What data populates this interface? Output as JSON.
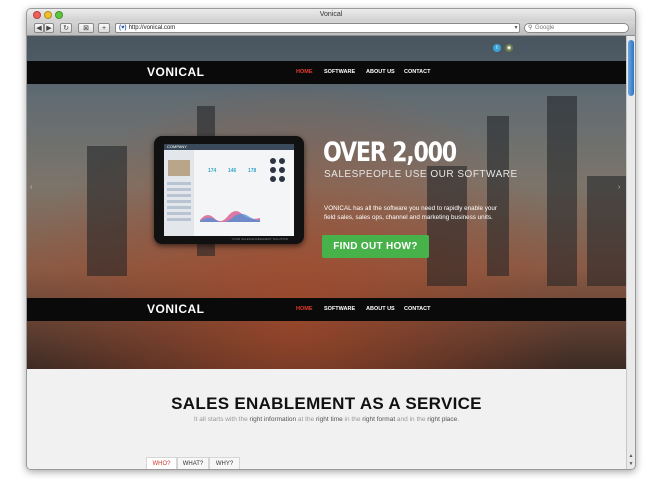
{
  "window": {
    "title": "Vonical"
  },
  "toolbar": {
    "back_icon": "back-arrow-icon",
    "forward_icon": "forward-arrow-icon",
    "reload_icon": "reload-icon",
    "url_prefix": "(♥)",
    "url": "http://vonical.com",
    "search_placeholder": "Google"
  },
  "site": {
    "logo": "VONICAL",
    "nav": [
      {
        "label": "HOME",
        "active": true
      },
      {
        "label": "SOFTWARE",
        "active": false
      },
      {
        "label": "ABOUT US",
        "active": false
      },
      {
        "label": "CONTACT",
        "active": false
      }
    ],
    "social": {
      "twitter_icon": "twitter-icon",
      "rss_icon": "rss-icon"
    }
  },
  "hero": {
    "headline": "OVER 2,000",
    "subheadline": "SALESPEOPLE USE OUR SOFTWARE",
    "body": "VONICAL has all the software you need to rapidly enable your field sales, sales ops, channel and marketing business units.",
    "cta": "FIND OUT HOW?",
    "tablet": {
      "brand": "COMPANY",
      "stats": [
        "174",
        "146",
        "178"
      ],
      "caption": "YOUR SALES ENABLEMENT SOLUTION"
    }
  },
  "section": {
    "title": "SALES ENABLEMENT AS A SERVICE",
    "subtitle_parts": [
      {
        "text": "It all starts with the ",
        "hl": false
      },
      {
        "text": "right information",
        "hl": true
      },
      {
        "text": " at the ",
        "hl": false
      },
      {
        "text": "right time",
        "hl": true
      },
      {
        "text": " in the ",
        "hl": false
      },
      {
        "text": "right format",
        "hl": true
      },
      {
        "text": " and in the ",
        "hl": false
      },
      {
        "text": "right place",
        "hl": true
      },
      {
        "text": ".",
        "hl": false
      }
    ],
    "tabs": [
      {
        "label": "WHO?",
        "active": true
      },
      {
        "label": "WHAT?",
        "active": false
      },
      {
        "label": "WHY?",
        "active": false
      }
    ]
  },
  "colors": {
    "accent_red": "#e63b2e",
    "cta_green": "#47b14a",
    "nav_bg": "#0a0a0a"
  }
}
